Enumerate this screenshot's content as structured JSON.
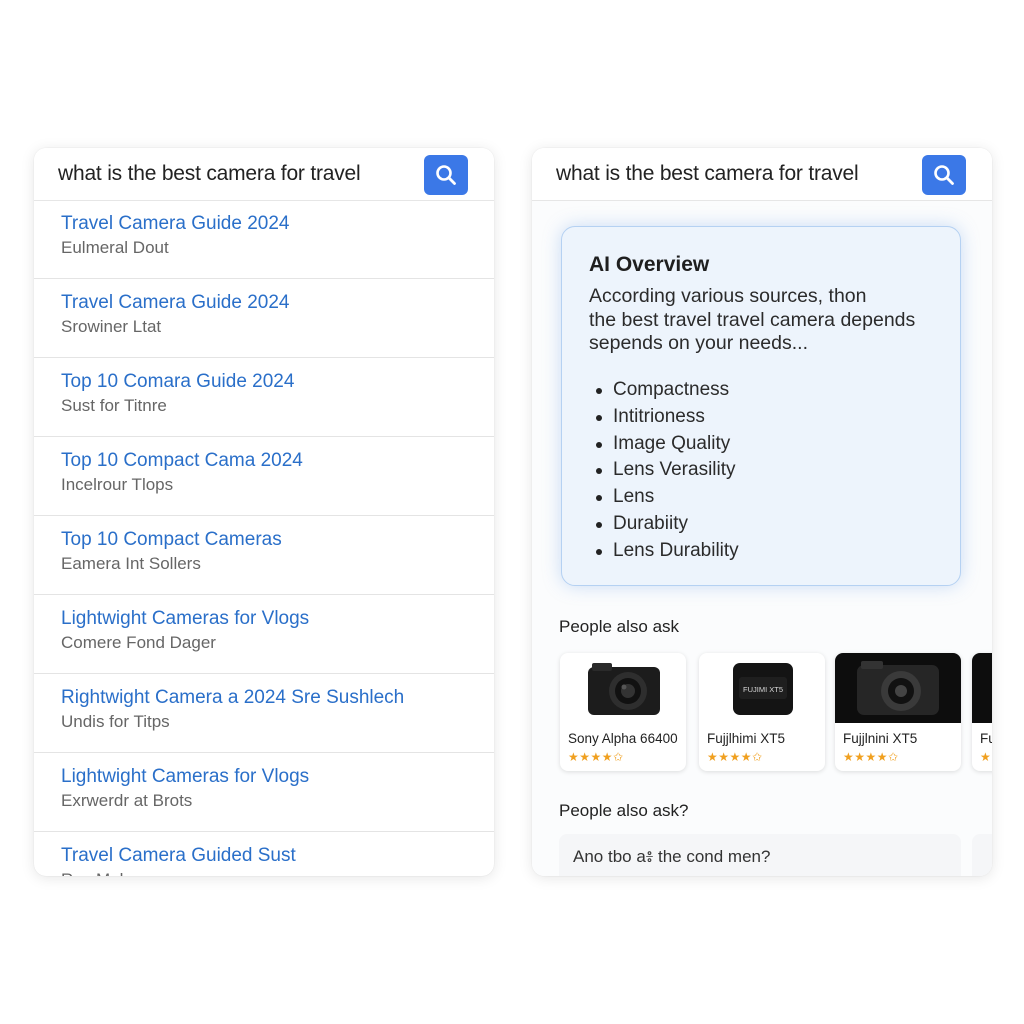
{
  "left_panel": {
    "search": {
      "query": "what is the best camera for travel"
    },
    "results": [
      {
        "title": "Travel Camera Guide 2024",
        "snippet": "Eulmeral Dout"
      },
      {
        "title": "Travel Camera Guide 2024",
        "snippet": "Srowiner Ltat"
      },
      {
        "title": "Top 10 Comara Guide 2024",
        "snippet": "Sust for Titnre"
      },
      {
        "title": "Top 10 Compact Cama 2024",
        "snippet": "Incelrour Tlops"
      },
      {
        "title": "Top 10 Compact Cameras",
        "snippet": "Eamera Int Sollers"
      },
      {
        "title": "Lightwight Cameras for Vlogs",
        "snippet": "Comere Fond Dager"
      },
      {
        "title": "Rightwight Camera  a 2024 Sre Sushlech",
        "snippet": "Undis for Titps"
      },
      {
        "title": "Lightwight Cameras for Vlogs",
        "snippet": "Exrwerdr at Brots"
      },
      {
        "title": "Travel Camera Guided Sust",
        "snippet": "Ruc Mobepessr"
      }
    ]
  },
  "right_panel": {
    "search": {
      "query": "what is the best camera for travel"
    },
    "ai_overview": {
      "title": "AI Overview",
      "lines": [
        "According various sources, thon",
        "the best travel travel camera depends",
        "sepends on your needs..."
      ],
      "bullets": [
        "Compactness",
        "Intitrioness",
        "Image Quality",
        "Lens Verasility",
        "Lens",
        "Durabiity",
        "Lens Durability"
      ]
    },
    "people_also_ask_label": "People also ask",
    "products": [
      {
        "name": "Sony Alpha 66400",
        "rating": 4.5,
        "stars": "★★★★✩"
      },
      {
        "name": "Fujjlhimi XT5",
        "rating": 4.5,
        "stars": "★★★★✩",
        "body_label": "FUJIMI XT5"
      },
      {
        "name": "Fujjlnini XT5",
        "rating": 4.5,
        "stars": "★★★★✩"
      },
      {
        "name": "Fu",
        "rating": 4,
        "stars": "★"
      }
    ],
    "people_also_ask_label_2": "People also ask?",
    "question": "Ano tbo a៖ the cond men?"
  },
  "colors": {
    "link": "#2a6fc9",
    "search_button": "#3b78e7",
    "ai_card_bg": "#edf4fc",
    "ai_card_border": "#b5d1f2",
    "star": "#f0a020"
  },
  "icons": [
    "search-icon",
    "camera-icon"
  ]
}
